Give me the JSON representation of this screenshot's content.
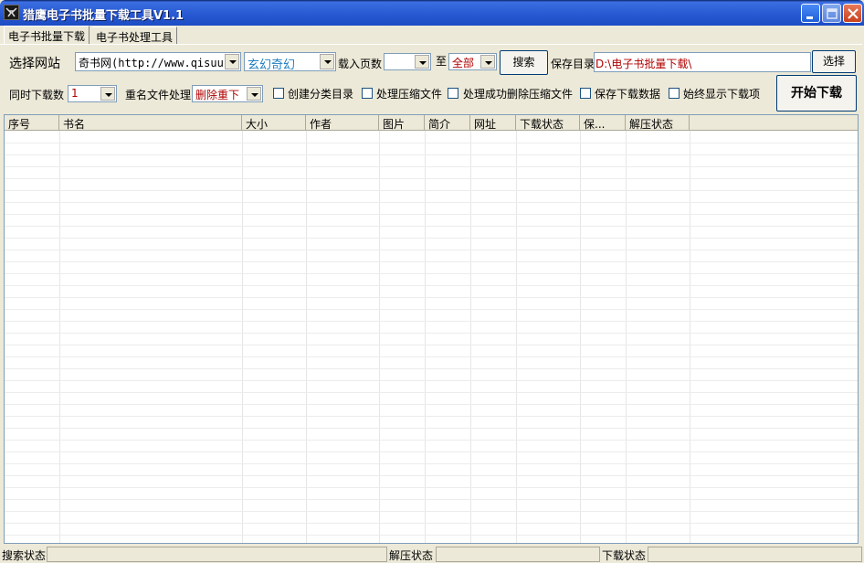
{
  "window": {
    "title": "猎鹰电子书批量下载工具V1.1"
  },
  "tabs": [
    {
      "label": "电子书批量下载"
    },
    {
      "label": "电子书处理工具"
    }
  ],
  "row1": {
    "site_label": "选择网站",
    "site_value": "奇书网(http://www.qisuu",
    "category_value": "玄幻奇幻",
    "pages_label": "载入页数",
    "pages_from_value": "",
    "to_label": "至",
    "pages_to_value": "全部",
    "search_button": "搜索",
    "save_dir_label": "保存目录",
    "save_dir_value": "D:\\电子书批量下载\\",
    "choose_button": "选择"
  },
  "row2": {
    "concurrent_label": "同时下载数",
    "concurrent_value": "1",
    "rename_label": "重名文件处理",
    "rename_value": "删除重下",
    "checkboxes": [
      {
        "label": "创建分类目录",
        "checked": false
      },
      {
        "label": "处理压缩文件",
        "checked": false
      },
      {
        "label": "处理成功删除压缩文件",
        "checked": false
      },
      {
        "label": "保存下载数据",
        "checked": false
      },
      {
        "label": "始终显示下载项",
        "checked": false
      }
    ],
    "start_button": "开始下载"
  },
  "table": {
    "columns": [
      "序号",
      "书名",
      "大小",
      "作者",
      "图片",
      "简介",
      "网址",
      "下载状态",
      "保...",
      "解压状态"
    ],
    "rows": []
  },
  "statusbar": {
    "search_label": "搜索状态",
    "search_value": "",
    "unzip_label": "解压状态",
    "unzip_value": "",
    "download_label": "下载状态",
    "download_value": ""
  },
  "colors": {
    "titlebar": "#2a5bd4",
    "category_text": "#1f7fc0",
    "alert_text": "#b00000"
  }
}
